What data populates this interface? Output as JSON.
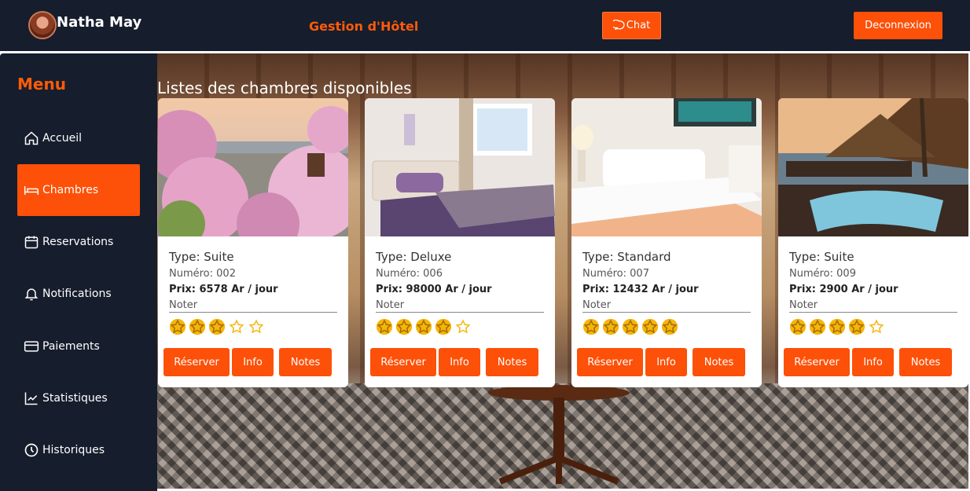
{
  "header": {
    "username": "Natha May",
    "app_title": "Gestion d'Hôtel",
    "chat_label": "Chat",
    "logout_label": "Deconnexion"
  },
  "sidebar": {
    "title": "Menu",
    "items": [
      {
        "label": "Accueil",
        "icon": "home-icon",
        "active": false
      },
      {
        "label": "Chambres",
        "icon": "bed-icon",
        "active": true
      },
      {
        "label": "Reservations",
        "icon": "calendar-icon",
        "active": false
      },
      {
        "label": "Notifications",
        "icon": "bell-icon",
        "active": false
      },
      {
        "label": "Paiements",
        "icon": "credit-card-icon",
        "active": false
      },
      {
        "label": "Statistiques",
        "icon": "chart-line-icon",
        "active": false
      },
      {
        "label": "Historiques",
        "icon": "clock-icon",
        "active": false
      }
    ]
  },
  "main": {
    "title": "Listes des chambres disponibles",
    "rooms": [
      {
        "type": "Type: Suite",
        "numero": "Numéro: 002",
        "prix": "Prix: 6578 Ar / jour",
        "noter": "Noter",
        "rating": 3,
        "image": "cherry-blossom-city-photo"
      },
      {
        "type": "Type: Deluxe",
        "numero": "Numéro: 006",
        "prix": "Prix: 98000 Ar / jour",
        "noter": "Noter",
        "rating": 4,
        "image": "purple-bedroom-photo"
      },
      {
        "type": "Type: Standard",
        "numero": "Numéro: 007",
        "prix": "Prix: 12432 Ar / jour",
        "noter": "Noter",
        "rating": 5,
        "image": "white-bedroom-photo"
      },
      {
        "type": "Type: Suite",
        "numero": "Numéro: 009",
        "prix": "Prix: 2900 Ar / jour",
        "noter": "Noter",
        "rating": 4,
        "image": "resort-pool-photo"
      }
    ],
    "buttons": {
      "reserve": "Réserver",
      "info": "Info",
      "notes": "Notes"
    }
  },
  "colors": {
    "accent": "#fd5008",
    "navy": "#161d2d",
    "star": "#f5b50a"
  }
}
